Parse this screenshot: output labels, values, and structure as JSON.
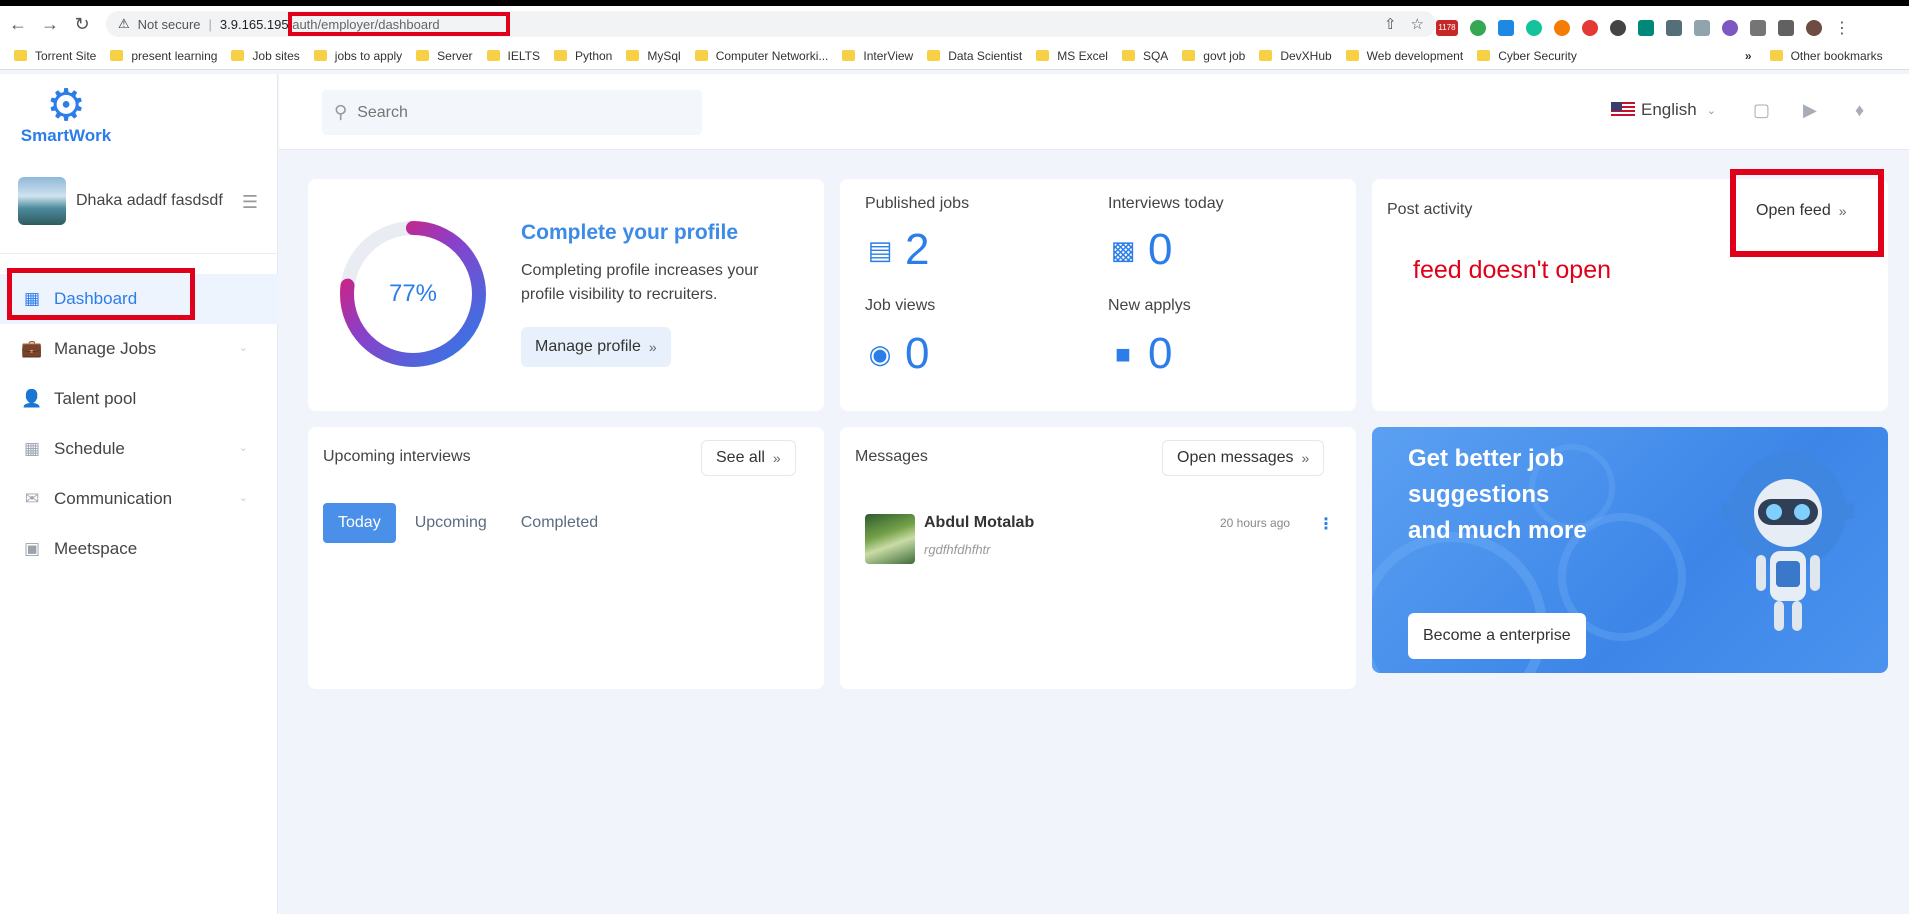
{
  "browser": {
    "not_secure_label": "Not secure",
    "url_host": "3.9.165.195",
    "url_path": "/auth/employer/dashboard",
    "ext_badge": "1178",
    "bookmarks": [
      "Torrent Site",
      "present learning",
      "Job sites",
      "jobs to apply",
      "Server",
      "IELTS",
      "Python",
      "MySql",
      "Computer Networki...",
      "InterView",
      "Data Scientist",
      "MS Excel",
      "SQA",
      "govt job",
      "DevXHub",
      "Web development",
      "Cyber Security"
    ],
    "bookmarks_more": "»",
    "other_bookmarks": "Other bookmarks"
  },
  "sidebar": {
    "logo_text": "SmartWork",
    "user_name": "Dhaka adadf fasdsdf",
    "items": [
      {
        "label": "Dashboard",
        "icon": "dashboard-icon"
      },
      {
        "label": "Manage Jobs",
        "icon": "briefcase-icon"
      },
      {
        "label": "Talent pool",
        "icon": "user-search-icon"
      },
      {
        "label": "Schedule",
        "icon": "calendar-icon"
      },
      {
        "label": "Communication",
        "icon": "chat-icon"
      },
      {
        "label": "Meetspace",
        "icon": "meetspace-icon"
      }
    ]
  },
  "topbar": {
    "search_placeholder": "Search",
    "language": "English"
  },
  "profile_card": {
    "percent_label": "77%",
    "percent": 0.77,
    "title": "Complete your profile",
    "description": "Completing profile increases your profile visibility to recruiters.",
    "button": "Manage profile"
  },
  "stats": {
    "published_jobs_label": "Published jobs",
    "published_jobs": "2",
    "interviews_today_label": "Interviews today",
    "interviews_today": "0",
    "job_views_label": "Job views",
    "job_views": "0",
    "new_applys_label": "New applys",
    "new_applys": "0"
  },
  "post_activity": {
    "title": "Post activity",
    "button": "Open feed",
    "annotation": "feed doesn't open"
  },
  "interviews": {
    "title": "Upcoming interviews",
    "see_all": "See all",
    "tabs": [
      "Today",
      "Upcoming",
      "Completed"
    ]
  },
  "messages": {
    "title": "Messages",
    "button": "Open messages",
    "items": [
      {
        "name": "Abdul Motalab",
        "text": "rgdfhfdhfhtr",
        "time": "20 hours ago"
      }
    ]
  },
  "promo": {
    "title": "Get better job suggestions and much more",
    "button": "Become a enterprise"
  },
  "colors": {
    "accent": "#2b7de9",
    "annotation_red": "#e0001a"
  }
}
